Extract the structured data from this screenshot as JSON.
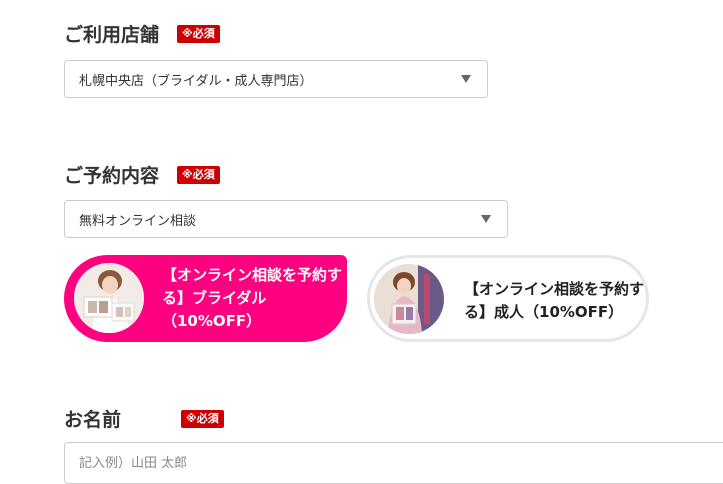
{
  "store": {
    "title": "ご利用店舗",
    "required_label": "※必須",
    "selected": "札幌中央店（ブライダル・成人専門店）"
  },
  "reservation": {
    "title": "ご予約内容",
    "required_label": "※必須",
    "selected": "無料オンライン相談",
    "choices": [
      {
        "label": "【オンライン相談を予約する】ブライダル（10%OFF）",
        "selected": true
      },
      {
        "label": "【オンライン相談を予約する】成人（10%OFF）",
        "selected": false
      }
    ]
  },
  "name": {
    "title": "お名前",
    "required_label": "※必須",
    "placeholder": "記入例）山田 太郎"
  },
  "colors": {
    "accent": "#ff0081",
    "badge": "#cc0000"
  }
}
